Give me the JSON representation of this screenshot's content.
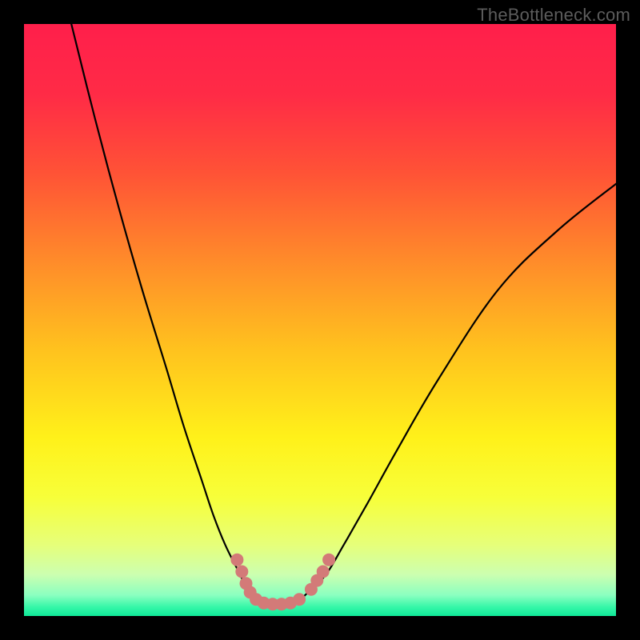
{
  "watermark": "TheBottleneck.com",
  "gradient": {
    "stops": [
      {
        "offset": 0.0,
        "color": "#ff1f4b"
      },
      {
        "offset": 0.12,
        "color": "#ff2b46"
      },
      {
        "offset": 0.25,
        "color": "#ff5236"
      },
      {
        "offset": 0.4,
        "color": "#ff8b2a"
      },
      {
        "offset": 0.55,
        "color": "#ffc21e"
      },
      {
        "offset": 0.7,
        "color": "#fff11a"
      },
      {
        "offset": 0.8,
        "color": "#f7ff3a"
      },
      {
        "offset": 0.88,
        "color": "#e6ff7a"
      },
      {
        "offset": 0.93,
        "color": "#ccffb0"
      },
      {
        "offset": 0.965,
        "color": "#8affc0"
      },
      {
        "offset": 0.985,
        "color": "#35f7a8"
      },
      {
        "offset": 1.0,
        "color": "#10e898"
      }
    ]
  },
  "chart_data": {
    "type": "line",
    "title": "",
    "xlabel": "",
    "ylabel": "",
    "xlim": [
      0,
      100
    ],
    "ylim": [
      0,
      100
    ],
    "series": [
      {
        "name": "bottleneck-curve",
        "x": [
          8,
          12,
          16,
          20,
          24,
          27,
          30,
          32,
          34,
          36,
          37.5,
          39,
          41,
          43,
          46,
          48,
          51,
          54,
          58,
          63,
          70,
          80,
          90,
          100
        ],
        "y": [
          100,
          84,
          69,
          55,
          42,
          32,
          23,
          17,
          12,
          8,
          5,
          3,
          2,
          2,
          2.5,
          4,
          7,
          12,
          19,
          28,
          40,
          55,
          65,
          73
        ]
      }
    ],
    "markers": {
      "name": "trough-markers",
      "color": "#d37a78",
      "points": [
        {
          "x": 36.0,
          "y": 9.5
        },
        {
          "x": 36.8,
          "y": 7.5
        },
        {
          "x": 37.5,
          "y": 5.5
        },
        {
          "x": 38.2,
          "y": 4.0
        },
        {
          "x": 39.2,
          "y": 2.8
        },
        {
          "x": 40.5,
          "y": 2.2
        },
        {
          "x": 42.0,
          "y": 2.0
        },
        {
          "x": 43.5,
          "y": 2.0
        },
        {
          "x": 45.0,
          "y": 2.2
        },
        {
          "x": 46.5,
          "y": 2.8
        },
        {
          "x": 48.5,
          "y": 4.5
        },
        {
          "x": 49.5,
          "y": 6.0
        },
        {
          "x": 50.5,
          "y": 7.5
        },
        {
          "x": 51.5,
          "y": 9.5
        }
      ]
    }
  }
}
